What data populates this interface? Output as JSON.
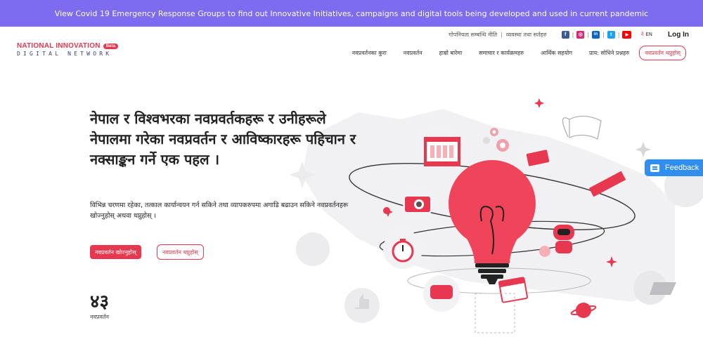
{
  "banner": {
    "text": "View Covid 19 Emergency Response Groups to find out Innovative Initiatives, campaigns and digital tools being developed and used in current pandemic"
  },
  "logo": {
    "line1": "NATIONAL INNOVATION",
    "badge": "Beta",
    "line2": "DIGITAL NETWORK"
  },
  "utility": {
    "privacy_policy": "गोपनियता सम्बन्धि नीति",
    "separator": "|",
    "terms": "व्यवस्था तथा सर्तहरु",
    "social": [
      {
        "name": "facebook-icon",
        "glyph": "f",
        "color": "#3b5998"
      },
      {
        "name": "instagram-icon",
        "glyph": "◎",
        "color": "#d62976"
      },
      {
        "name": "linkedin-icon",
        "glyph": "in",
        "color": "#0a66c2"
      },
      {
        "name": "twitter-icon",
        "glyph": "t",
        "color": "#1da1f2"
      },
      {
        "name": "youtube-icon",
        "glyph": "▶",
        "color": "#ff0000"
      }
    ],
    "lang_ne": "ने",
    "lang_en": "EN",
    "login": "Log In"
  },
  "nav": {
    "items": [
      "नवप्रवर्तनका कुरा",
      "नवप्रवर्तन",
      "हाम्रो बारेमा",
      "समाचार र कार्यक्रमहरु",
      "आर्थिक सहयोग",
      "प्राय: सोधिने प्रश्नहरु"
    ],
    "cta": "नवप्रवर्तन थप्नुहोस्"
  },
  "hero": {
    "title": "नेपाल र विश्वभरका नवप्रवर्तकहरू र उनीहरूले नेपालमा गरेका नवप्रवर्तन र आविष्कारहरू पहिचान र नक्साङ्कन गर्ने एक पहल ।",
    "subtitle": "विभिन्न चरणमा रहेका, तत्काल कार्यान्वयन गर्न सकिने तथा व्यापकरुपमा अगाडि बढाउन सकिने नवप्रवर्तनहरू खोज्नुहोस् अथवा थप्नुहोस् ।",
    "primary_button": "नवप्रवर्तन खोज्नुहोस्",
    "secondary_button": "नवप्रवर्तन थप्नुहोस्",
    "stat_value": "४३",
    "stat_label": "नवप्रवर्तन"
  },
  "feedback": {
    "label": "Feedback"
  },
  "colors": {
    "banner": "#7b6cf0",
    "accent": "#e8384f",
    "feedback": "#2f8ef0"
  }
}
